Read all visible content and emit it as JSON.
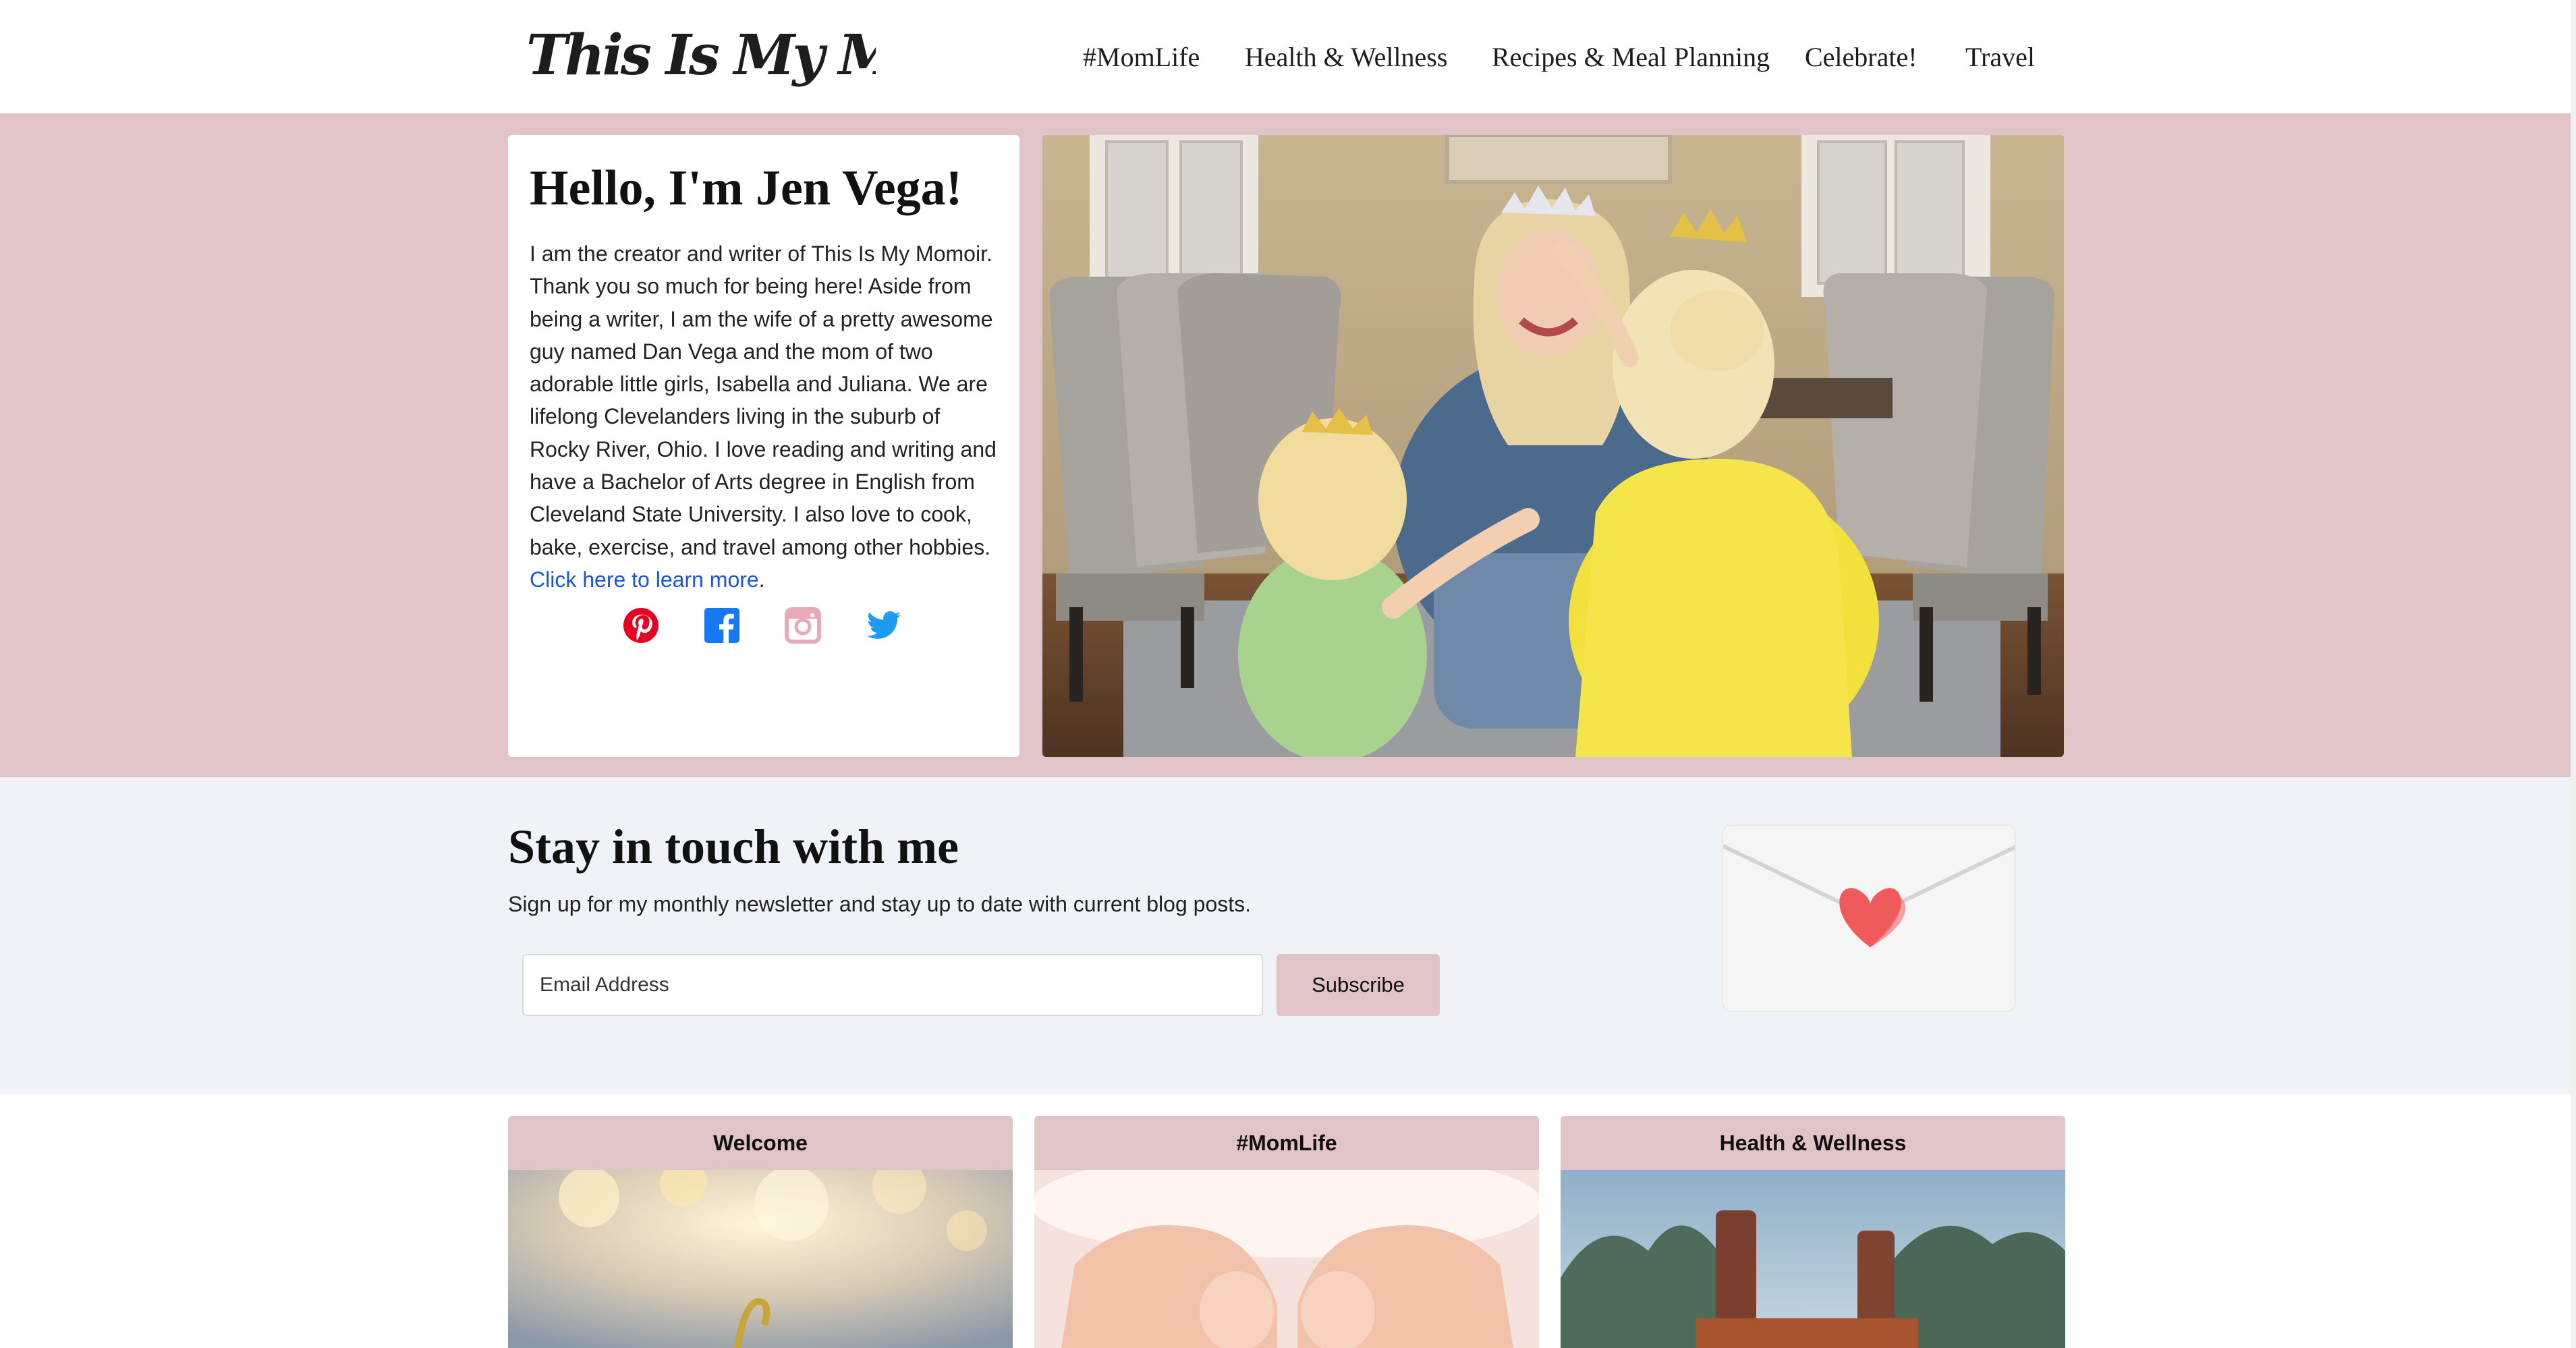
{
  "header": {
    "logo_text": "This Is My Momoir",
    "nav": [
      "#MomLife",
      "Health & Wellness",
      "Recipes & Meal Planning",
      "Celebrate!",
      "Travel"
    ]
  },
  "bio": {
    "title": "Hello, I'm Jen Vega!",
    "text": "I am the creator and writer of This Is My Momoir. Thank you so much for being here! Aside from being a writer, I am the wife of a pretty awesome guy named Dan Vega and the mom of two adorable little girls, Isabella and Juliana. We are lifelong Clevelanders living in the suburb of Rocky River, Ohio. I love reading and writing and have a Bachelor of Arts degree in English from Cleveland State University. I also love to cook, bake, exercise, and travel among other hobbies. ",
    "link_text": "Click here to learn more",
    "after_link": ".",
    "social": [
      "pinterest-icon",
      "facebook-icon",
      "instagram-icon",
      "twitter-icon"
    ]
  },
  "newsletter": {
    "title": "Stay in touch with me",
    "subtitle": "Sign up for my monthly newsletter and stay up to date with current blog posts.",
    "email_placeholder": "Email Address",
    "button_label": "Subscribe"
  },
  "cards": [
    {
      "title": "Welcome"
    },
    {
      "title": "#MomLife"
    },
    {
      "title": "Health & Wellness"
    }
  ],
  "colors": {
    "accent_pink": "#e0c4c8",
    "newsletter_bg": "#eff2f7",
    "link_blue": "#1a56db"
  }
}
